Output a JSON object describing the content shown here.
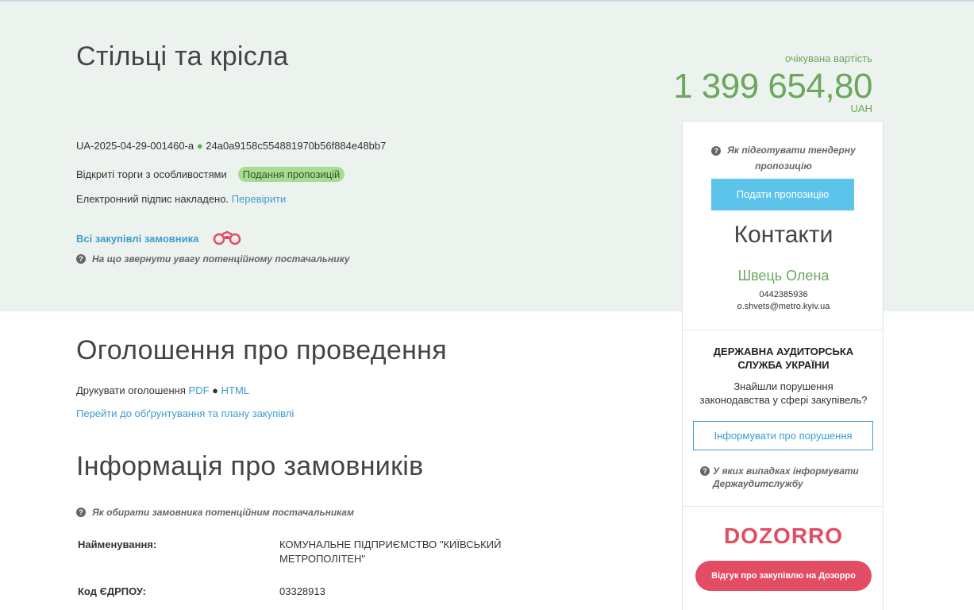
{
  "tender": {
    "title": "Стільці та крісла",
    "expected_label": "очікувана вартість",
    "expected_value": "1 399 654,80",
    "currency": "UAH",
    "tender_id": "UA-2025-04-29-001460-a",
    "hash": "24a0a9158c554881970b56f884e48bb7",
    "procedure_type": "Відкриті торги з особливостями",
    "status_badge": "Подання пропозицій",
    "signature_text": "Електронний підпис накладено.",
    "signature_check_link": "Перевірити",
    "all_purchases_link": "Всі закупівлі замовника",
    "supplier_hint": "На що звернути увагу потенційному постачальнику"
  },
  "announcement": {
    "heading": "Оголошення про проведення",
    "print_label": "Друкувати оголошення",
    "pdf_link": "PDF",
    "html_link": "HTML",
    "plan_link": "Перейти до обґрунтування та плану закупівлі"
  },
  "customer": {
    "heading": "Інформація про замовників",
    "hint": "Як обирати замовника потенційним постачальникам",
    "rows": [
      {
        "label": "Найменування:",
        "value": "КОМУНАЛЬНЕ ПІДПРИЄМСТВО \"КИЇВСЬКИЙ МЕТРОПОЛІТЕН\""
      },
      {
        "label": "Код ЄДРПОУ:",
        "value": "03328913"
      }
    ]
  },
  "sidebar": {
    "prepare_hint": "Як підготувати тендерну пропозицію",
    "submit_button": "Подати пропозицію",
    "contacts_title": "Контакти",
    "contact_name": "Швець Олена",
    "contact_phone": "0442385936",
    "contact_email": "o.shvets@metro.kyiv.ua",
    "audit_title": "ДЕРЖАВНА АУДИТОРСЬКА СЛУЖБА УКРАЇНИ",
    "audit_question": "Знайшли порушення законодавства у сфері закупівель?",
    "inform_button": "Інформувати про порушення",
    "audit_hint": "У яких випадках інформувати Держаудитслужбу",
    "dozorro_logo": "DOZORRO",
    "dozorro_button": "Відгук про закупівлю на Дозорро"
  },
  "colors": {
    "accent_green": "#6ba75c",
    "link_blue": "#3d9ccd",
    "dozorro_red": "#e24d64",
    "hero_bg": "#ecf3ee"
  }
}
